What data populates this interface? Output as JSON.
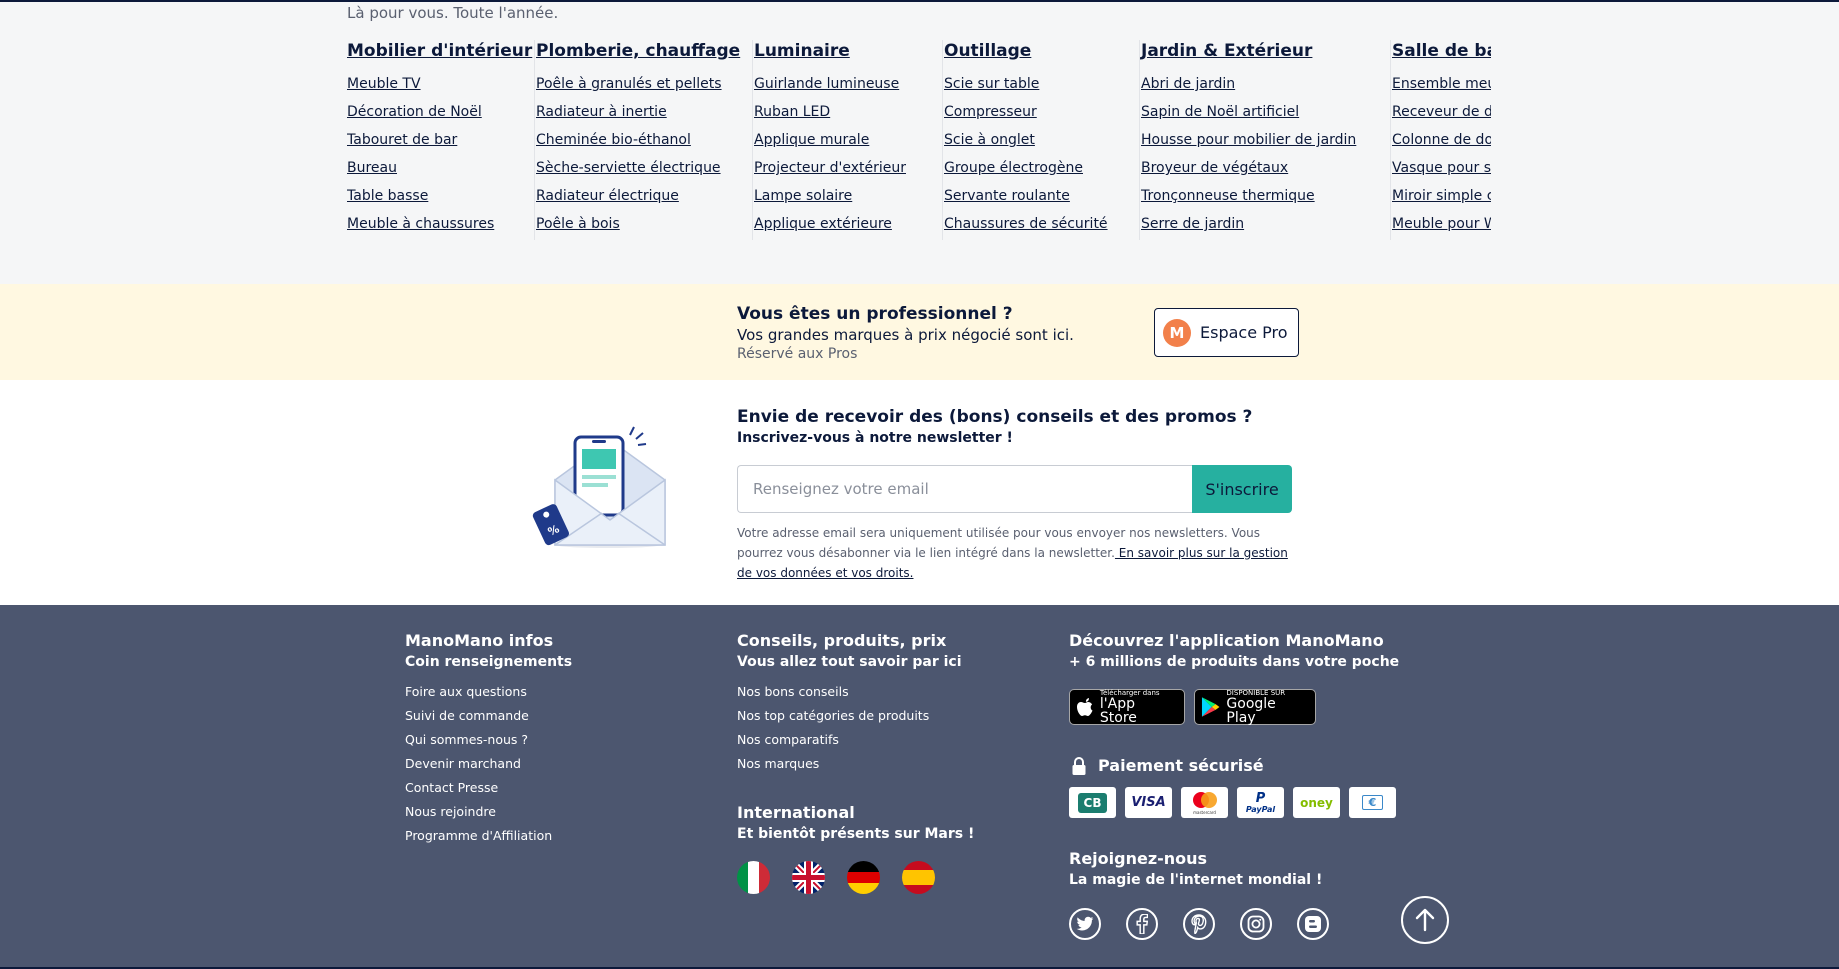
{
  "categories": {
    "tagline": "Là pour vous. Toute l'année.",
    "columns": [
      {
        "title": "Mobilier d'intérieur",
        "links": [
          "Meuble TV",
          "Décoration de Noël",
          "Tabouret de bar",
          "Bureau",
          "Table basse",
          "Meuble à chaussures"
        ]
      },
      {
        "title": "Plomberie, chauffage",
        "links": [
          "Poêle à granulés et pellets",
          "Radiateur à inertie",
          "Cheminée bio-éthanol",
          "Sèche-serviette électrique",
          "Radiateur électrique",
          "Poêle à bois"
        ]
      },
      {
        "title": "Luminaire",
        "links": [
          "Guirlande lumineuse",
          "Ruban LED",
          "Applique murale",
          "Projecteur d'extérieur",
          "Lampe solaire",
          "Applique extérieure"
        ]
      },
      {
        "title": "Outillage",
        "links": [
          "Scie sur table",
          "Compresseur",
          "Scie à onglet",
          "Groupe électrogène",
          "Servante roulante",
          "Chaussures de sécurité"
        ]
      },
      {
        "title": "Jardin & Extérieur",
        "links": [
          "Abri de jardin",
          "Sapin de Noël artificiel",
          "Housse pour mobilier de jardin",
          "Broyeur de végétaux",
          "Tronçonneuse thermique",
          "Serre de jardin"
        ]
      },
      {
        "title": "Salle de bain",
        "links": [
          "Ensemble meuble",
          "Receveur de douche",
          "Colonne de douche",
          "Vasque pour salle de bain",
          "Miroir simple clair",
          "Meuble pour WC"
        ]
      }
    ]
  },
  "pro": {
    "title": "Vous êtes un professionnel ?",
    "subtitle": "Vos grandes marques à prix négocié sont ici.",
    "note": "Réservé aux Pros",
    "button_label": "Espace Pro",
    "logo_letter": "M"
  },
  "newsletter": {
    "title": "Envie de recevoir des (bons) conseils et des promos ?",
    "subtitle": "Inscrivez-vous à notre newsletter !",
    "placeholder": "Renseignez votre email",
    "button_label": "S'inscrire",
    "legal_text": "Votre adresse email sera uniquement utilisée pour vous envoyer nos newsletters. Vous pourrez vous désabonner via le lien intégré dans la newsletter.",
    "legal_link": " En savoir plus sur la gestion de vos données et vos droits."
  },
  "footer": {
    "infos": {
      "title": "ManoMano infos",
      "subtitle": "Coin renseignements",
      "links": [
        "Foire aux questions",
        "Suivi de commande",
        "Qui sommes-nous ?",
        "Devenir marchand",
        "Contact Presse",
        "Nous rejoindre",
        "Programme d'Affiliation"
      ]
    },
    "advice": {
      "title": "Conseils, produits, prix",
      "subtitle": "Vous allez tout savoir par ici",
      "links": [
        "Nos bons conseils",
        "Nos top catégories de produits",
        "Nos comparatifs",
        "Nos marques"
      ]
    },
    "international": {
      "title": "International",
      "subtitle": "Et bientôt présents sur Mars !",
      "flags": [
        "italy-flag",
        "uk-flag",
        "germany-flag",
        "spain-flag"
      ]
    },
    "app": {
      "title": "Découvrez l'application ManoMano",
      "subtitle": "+ 6 millions de produits dans votre poche",
      "app_store_small": "Télécharger dans",
      "app_store_big": "l'App Store",
      "google_play_small": "DISPONIBLE SUR",
      "google_play_big": "Google Play"
    },
    "payment": {
      "title": "Paiement sécurisé",
      "cards": [
        "CB",
        "VISA",
        "mastercard",
        "PayPal",
        "oney",
        "€"
      ]
    },
    "social": {
      "title": "Rejoignez-nous",
      "subtitle": "La magie de l'internet mondial !",
      "icons": [
        "twitter-icon",
        "facebook-icon",
        "pinterest-icon",
        "instagram-icon",
        "blog-icon"
      ]
    }
  },
  "colors": {
    "navy": "#0c193a",
    "footer_bg": "#4c566f",
    "pro_bg": "#fff8e1",
    "teal": "#26b0a0",
    "orange": "#f2804a"
  }
}
